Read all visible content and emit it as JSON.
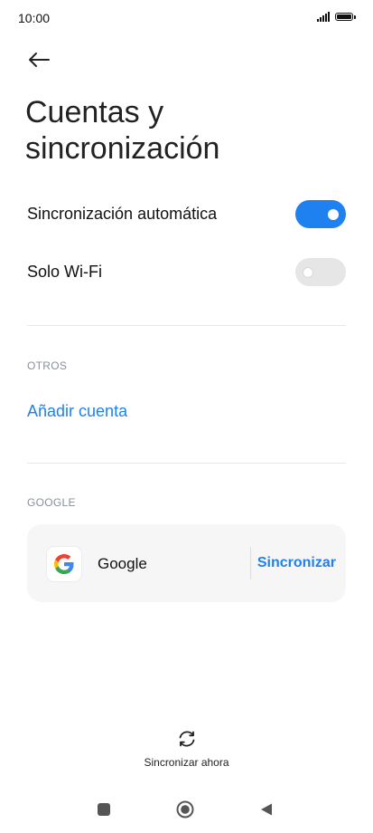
{
  "status_bar": {
    "time": "10:00",
    "signal_icon": "signal-icon",
    "battery_icon": "battery-icon"
  },
  "header": {
    "back_icon": "arrow-left-icon",
    "title": "Cuentas y sincronización"
  },
  "settings": {
    "auto_sync": {
      "label": "Sincronización automática",
      "state": "on"
    },
    "wifi_only": {
      "label": "Solo Wi-Fi",
      "state": "off"
    }
  },
  "others": {
    "section_label": "OTROS",
    "add_account": "Añadir cuenta"
  },
  "google_section": {
    "section_label": "GOOGLE",
    "account_name": "Google",
    "sync_button": "Sincronizar",
    "logo_icon": "google-logo-icon"
  },
  "footer": {
    "sync_now_label": "Sincronizar ahora",
    "sync_icon": "sync-icon"
  },
  "nav": {
    "recents_icon": "square-icon",
    "home_icon": "circle-icon",
    "back_icon": "triangle-back-icon"
  },
  "colors": {
    "accent": "#1f81f0",
    "toggle_off": "#e6e6e6",
    "section_label": "#8a8f98",
    "card_background": "#f6f6f6"
  }
}
